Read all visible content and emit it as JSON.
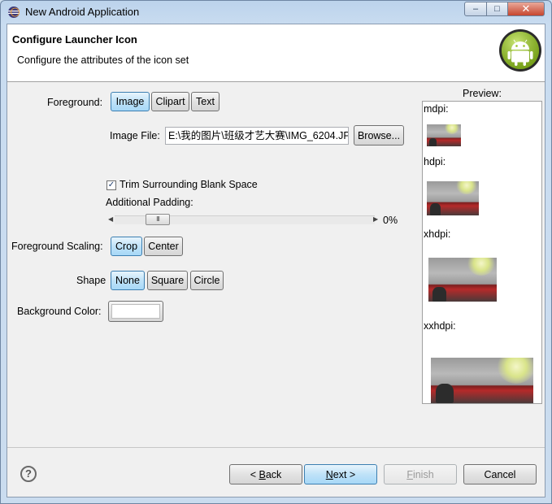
{
  "window": {
    "title": "New Android Application",
    "controls": {
      "minimize": "–",
      "maximize": "□",
      "close": "✕"
    }
  },
  "header": {
    "title": "Configure Launcher Icon",
    "subtitle": "Configure the attributes of the icon set"
  },
  "foreground": {
    "label": "Foreground:",
    "options": [
      "Image",
      "Clipart",
      "Text"
    ],
    "selected": "Image"
  },
  "image_file": {
    "label": "Image File:",
    "value": "E:\\我的图片\\班级才艺大赛\\IMG_6204.JP",
    "browse_label": "Browse..."
  },
  "trim": {
    "label": "Trim Surrounding Blank Space",
    "checked": true
  },
  "padding": {
    "label": "Additional Padding:",
    "value_text": "0%",
    "thumb_grip": "III"
  },
  "scaling": {
    "label": "Foreground Scaling:",
    "options": [
      "Crop",
      "Center"
    ],
    "selected": "Crop"
  },
  "shape": {
    "label": "Shape",
    "options": [
      "None",
      "Square",
      "Circle"
    ],
    "selected": "None"
  },
  "background_color": {
    "label": "Background Color:",
    "value": "#ffffff"
  },
  "preview": {
    "label": "Preview:",
    "densities": [
      "mdpi:",
      "hdpi:",
      "xhdpi:",
      "xxhdpi:"
    ]
  },
  "footer": {
    "help": "?",
    "back_prefix": "< ",
    "back_mnemonic": "B",
    "back_rest": "ack",
    "next_mnemonic": "N",
    "next_rest": "ext >",
    "finish_mnemonic": "F",
    "finish_rest": "inish",
    "cancel": "Cancel"
  },
  "colors": {
    "selected_button": "#a7d8f7",
    "window_frame": "#c9dcf0",
    "close_button": "#c7462f",
    "android_green": "#97c024"
  }
}
